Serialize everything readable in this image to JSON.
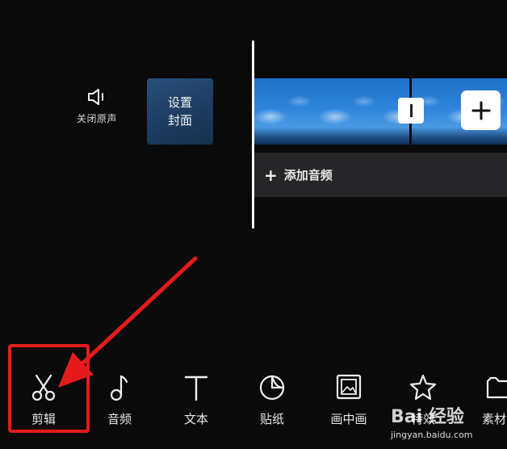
{
  "timeline": {
    "mute_label": "关闭原声",
    "cover_label": "设置\n封面",
    "add_audio_label": "添加音频",
    "add_audio_plus": "+"
  },
  "toolbar": {
    "items": [
      {
        "label": "剪辑",
        "icon": "scissors-icon"
      },
      {
        "label": "音频",
        "icon": "music-note-icon"
      },
      {
        "label": "文本",
        "icon": "text-icon"
      },
      {
        "label": "贴纸",
        "icon": "sticker-icon"
      },
      {
        "label": "画中画",
        "icon": "picture-in-picture-icon"
      },
      {
        "label": "特效",
        "icon": "star-effects-icon"
      },
      {
        "label": "素材",
        "icon": "material-icon"
      }
    ]
  },
  "annotation": {
    "color": "#e51b1b"
  },
  "watermark": {
    "main": "Bai 经验",
    "sub": "jingyan.baidu.com"
  }
}
